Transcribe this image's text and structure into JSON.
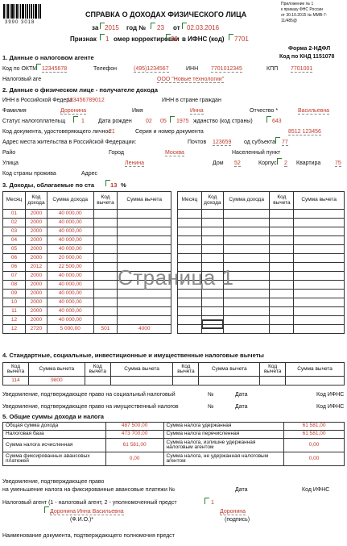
{
  "barcode_number": "3990 3018",
  "appendix": [
    "Приложение № 1",
    "к приказу ФНС России",
    "от 30.10.2015 № ММВ-7-",
    "11/485@"
  ],
  "title": "СПРАВКА О ДОХОДАХ ФИЗИЧЕСКОГО ЛИЦА",
  "header": {
    "za": "за",
    "year": "2015",
    "god_no": "год №",
    "number": "23",
    "ot": "от",
    "date": "02.03.2016",
    "priznak": "Признак",
    "priznak_val": "1",
    "korr": "омер корректировки",
    "korr_val": "00",
    "ifns": "в ИФНС (код)",
    "ifns_val": "7701"
  },
  "form": {
    "name": "Форма 2-НДФЛ",
    "knd": "Код по КНД 1151078"
  },
  "s1": {
    "title": "1. Данные о налоговом агенте",
    "okt_label": "Код по ОКТМ",
    "okt": "12345678",
    "tel_label": "Телефон",
    "tel": "(495)1234567",
    "inn_label": "ИНН",
    "inn": "7701012345",
    "kpp_label": "КПП",
    "kpp": "7701001",
    "agent_label": "Налоговый аге",
    "agent": "ООО \"Новые технологии\""
  },
  "s2": {
    "title": "2. Данные о физическом лице - получателе дохода",
    "inn_rf_label": "ИНН в Российской Федера",
    "inn_rf": "123456789012",
    "inn_foreign_label": "ИНН в стране граждан",
    "fam_label": "Фамилия",
    "fam": "Доронина",
    "name_label": "Имя",
    "name": "Инна",
    "otch_label": "Отчество *",
    "otch": "Васильевна",
    "status_label": "Статус налогоплательщ",
    "status": "1",
    "dob_label": "Дата рожден",
    "dob_d": "02",
    "dob_m": "05",
    "dob_y": "1975",
    "citizen_label": "жданство (код страны)",
    "citizen": "643",
    "doc_label": "Код документа, удостоверяющего личнос",
    "doc": "21",
    "series_label": "Серия и номер документа",
    "series": "8512 123456",
    "addr_label": "Адрес места жительства в Российской Федерации:",
    "post_label": "Почтов",
    "post": "123659",
    "region_code_label": "од субъекта",
    "region_code": "77",
    "rayon_label": "Райо",
    "city_label": "Город",
    "city": "Москва",
    "np_label": "Населенный пункт",
    "street_label": "Улица",
    "street": "Ленина",
    "house_label": "Дом",
    "house": "52",
    "korp_label": "Корпус",
    "korp": "2",
    "kv_label": "Квартира",
    "kv": "75",
    "country_label": "Код страны прожива",
    "address_label": "Адрес"
  },
  "s3": {
    "title": "3. Доходы, облагаемые по ста",
    "rate": "13",
    "pct": "%",
    "headers": [
      "Месяц",
      "Код дохода",
      "Сумма дохода",
      "Код вычета",
      "Сумма вычета"
    ],
    "rows": [
      [
        "01",
        "2000",
        "40 000,00",
        "",
        ""
      ],
      [
        "02",
        "2000",
        "40 000,00",
        "",
        ""
      ],
      [
        "03",
        "2000",
        "40 000,00",
        "",
        ""
      ],
      [
        "04",
        "2000",
        "40 000,00",
        "",
        ""
      ],
      [
        "05",
        "2000",
        "40 000,00",
        "",
        ""
      ],
      [
        "06",
        "2000",
        "20 000,00",
        "",
        ""
      ],
      [
        "06",
        "2012",
        "22 500,00",
        "",
        ""
      ],
      [
        "07",
        "2000",
        "40 000,00",
        "",
        ""
      ],
      [
        "08",
        "2000",
        "40 000,00",
        "",
        ""
      ],
      [
        "09",
        "2000",
        "40 000,00",
        "",
        ""
      ],
      [
        "10",
        "2000",
        "40 000,00",
        "",
        ""
      ],
      [
        "11",
        "2000",
        "40 000,00",
        "",
        ""
      ],
      [
        "12",
        "2000",
        "40 000,00",
        "",
        ""
      ],
      [
        "12",
        "2720",
        "5 000,00",
        "501",
        "4000"
      ]
    ],
    "watermark": "Страница 1"
  },
  "s4": {
    "title": "4. Стандартные, социальные, инвестиционные и имущественные налоговые вычеты",
    "headers": [
      "Код вычета",
      "Сумма вычета",
      "Код вычета",
      "Сумма вычета",
      "Код вычета",
      "Сумма вычета",
      "Код вычета",
      "Сумма вычета"
    ],
    "row": [
      "114",
      "9800",
      "",
      "",
      "",
      "",
      "",
      ""
    ],
    "notice_social": "Уведомление, подтверждающее право на социальный налоговый",
    "notice_property": "Уведомление, подтверждающее право на имущественный налогов",
    "no": "№",
    "date": "Дата",
    "ifns": "Код ИФНС"
  },
  "s5": {
    "title": "5. Общие суммы дохода и налога",
    "rows": [
      [
        "Общая сумма дохода",
        "487 500,00",
        "Сумма налога удержанная",
        "61 581,00"
      ],
      [
        "Налоговая база",
        "473 700,00",
        "Сумма налога перечисленная",
        "61 581,00"
      ],
      [
        "Сумма налога исчисленная",
        "61 581,00",
        "Сумма налога, излишне удержанная налоговым агентом",
        "0,00"
      ],
      [
        "Сумма фиксированных авансовых платежей",
        "0,00",
        "Сумма налога, не удержанная налоговым агентом",
        "0,00"
      ]
    ],
    "notice1": "Уведомление, подтверждающее право",
    "notice2": "на уменьшение налога на фиксированные авансовые платежи №",
    "date": "Дата",
    "ifns": "Код ИФНС"
  },
  "footer": {
    "agent_label": "Налоговый агент (1 - налоговый агент, 2 - уполномоченный предст",
    "agent_val": "1",
    "fio": "Доронина Инна Васильевна",
    "fio_caption": "(Ф.И.О.)*",
    "sign": "Доронина",
    "sign_caption": "(подпись)",
    "doc_label": "Наименование документа, подтверждающего полномочия предст"
  }
}
